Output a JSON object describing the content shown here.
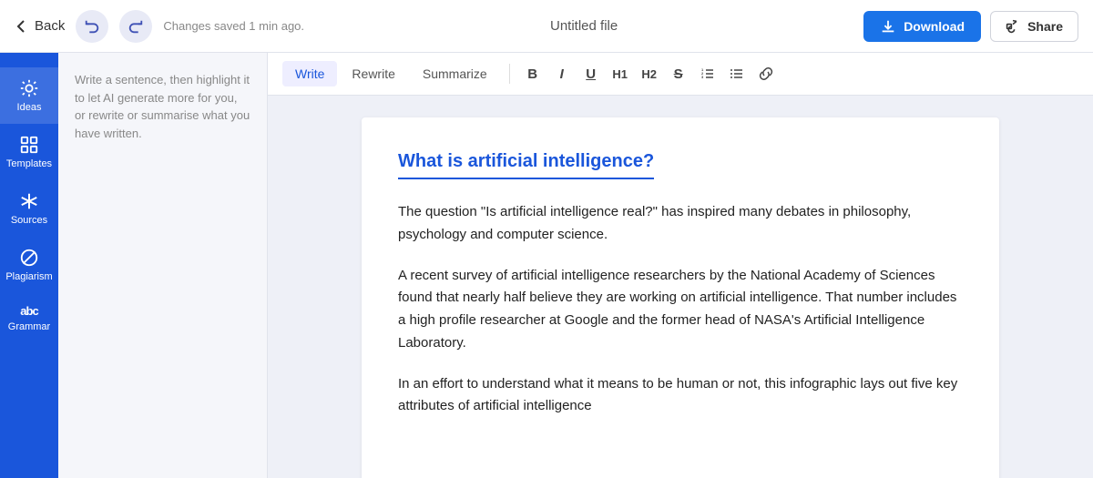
{
  "topbar": {
    "back_label": "Back",
    "saved_text": "Changes saved 1 min ago.",
    "file_title": "Untitled file",
    "download_label": "Download",
    "share_label": "Share"
  },
  "sidebar": {
    "items": [
      {
        "id": "ideas",
        "label": "Ideas",
        "icon": "sun"
      },
      {
        "id": "templates",
        "label": "Templates",
        "icon": "grid"
      },
      {
        "id": "sources",
        "label": "Sources",
        "icon": "asterisk"
      },
      {
        "id": "plagiarism",
        "label": "Plagiarism",
        "icon": "circle-slash"
      },
      {
        "id": "grammar",
        "label": "Grammar",
        "icon": "abc"
      }
    ]
  },
  "left_panel": {
    "hint": "Write a sentence, then highlight it to let AI generate more for you, or rewrite or summarise what you have written."
  },
  "toolbar": {
    "tabs": [
      {
        "id": "write",
        "label": "Write",
        "active": true
      },
      {
        "id": "rewrite",
        "label": "Rewrite",
        "active": false
      },
      {
        "id": "summarize",
        "label": "Summarize",
        "active": false
      }
    ],
    "bold": "B",
    "italic": "I",
    "underline": "U",
    "h1": "H1",
    "h2": "H2"
  },
  "document": {
    "title": "What is artificial intelligence?",
    "paragraphs": [
      "The question \"Is artificial intelligence real?\" has inspired many debates in philosophy, psychology and computer science.",
      "A recent survey of artificial intelligence researchers by the National Academy of Sciences found that nearly half believe they are working on artificial intelligence. That number includes a high profile researcher at Google and the former head of NASA's Artificial Intelligence Laboratory.",
      "In an effort to understand what it means to be human or not, this infographic lays out five key attributes of artificial intelligence"
    ]
  }
}
